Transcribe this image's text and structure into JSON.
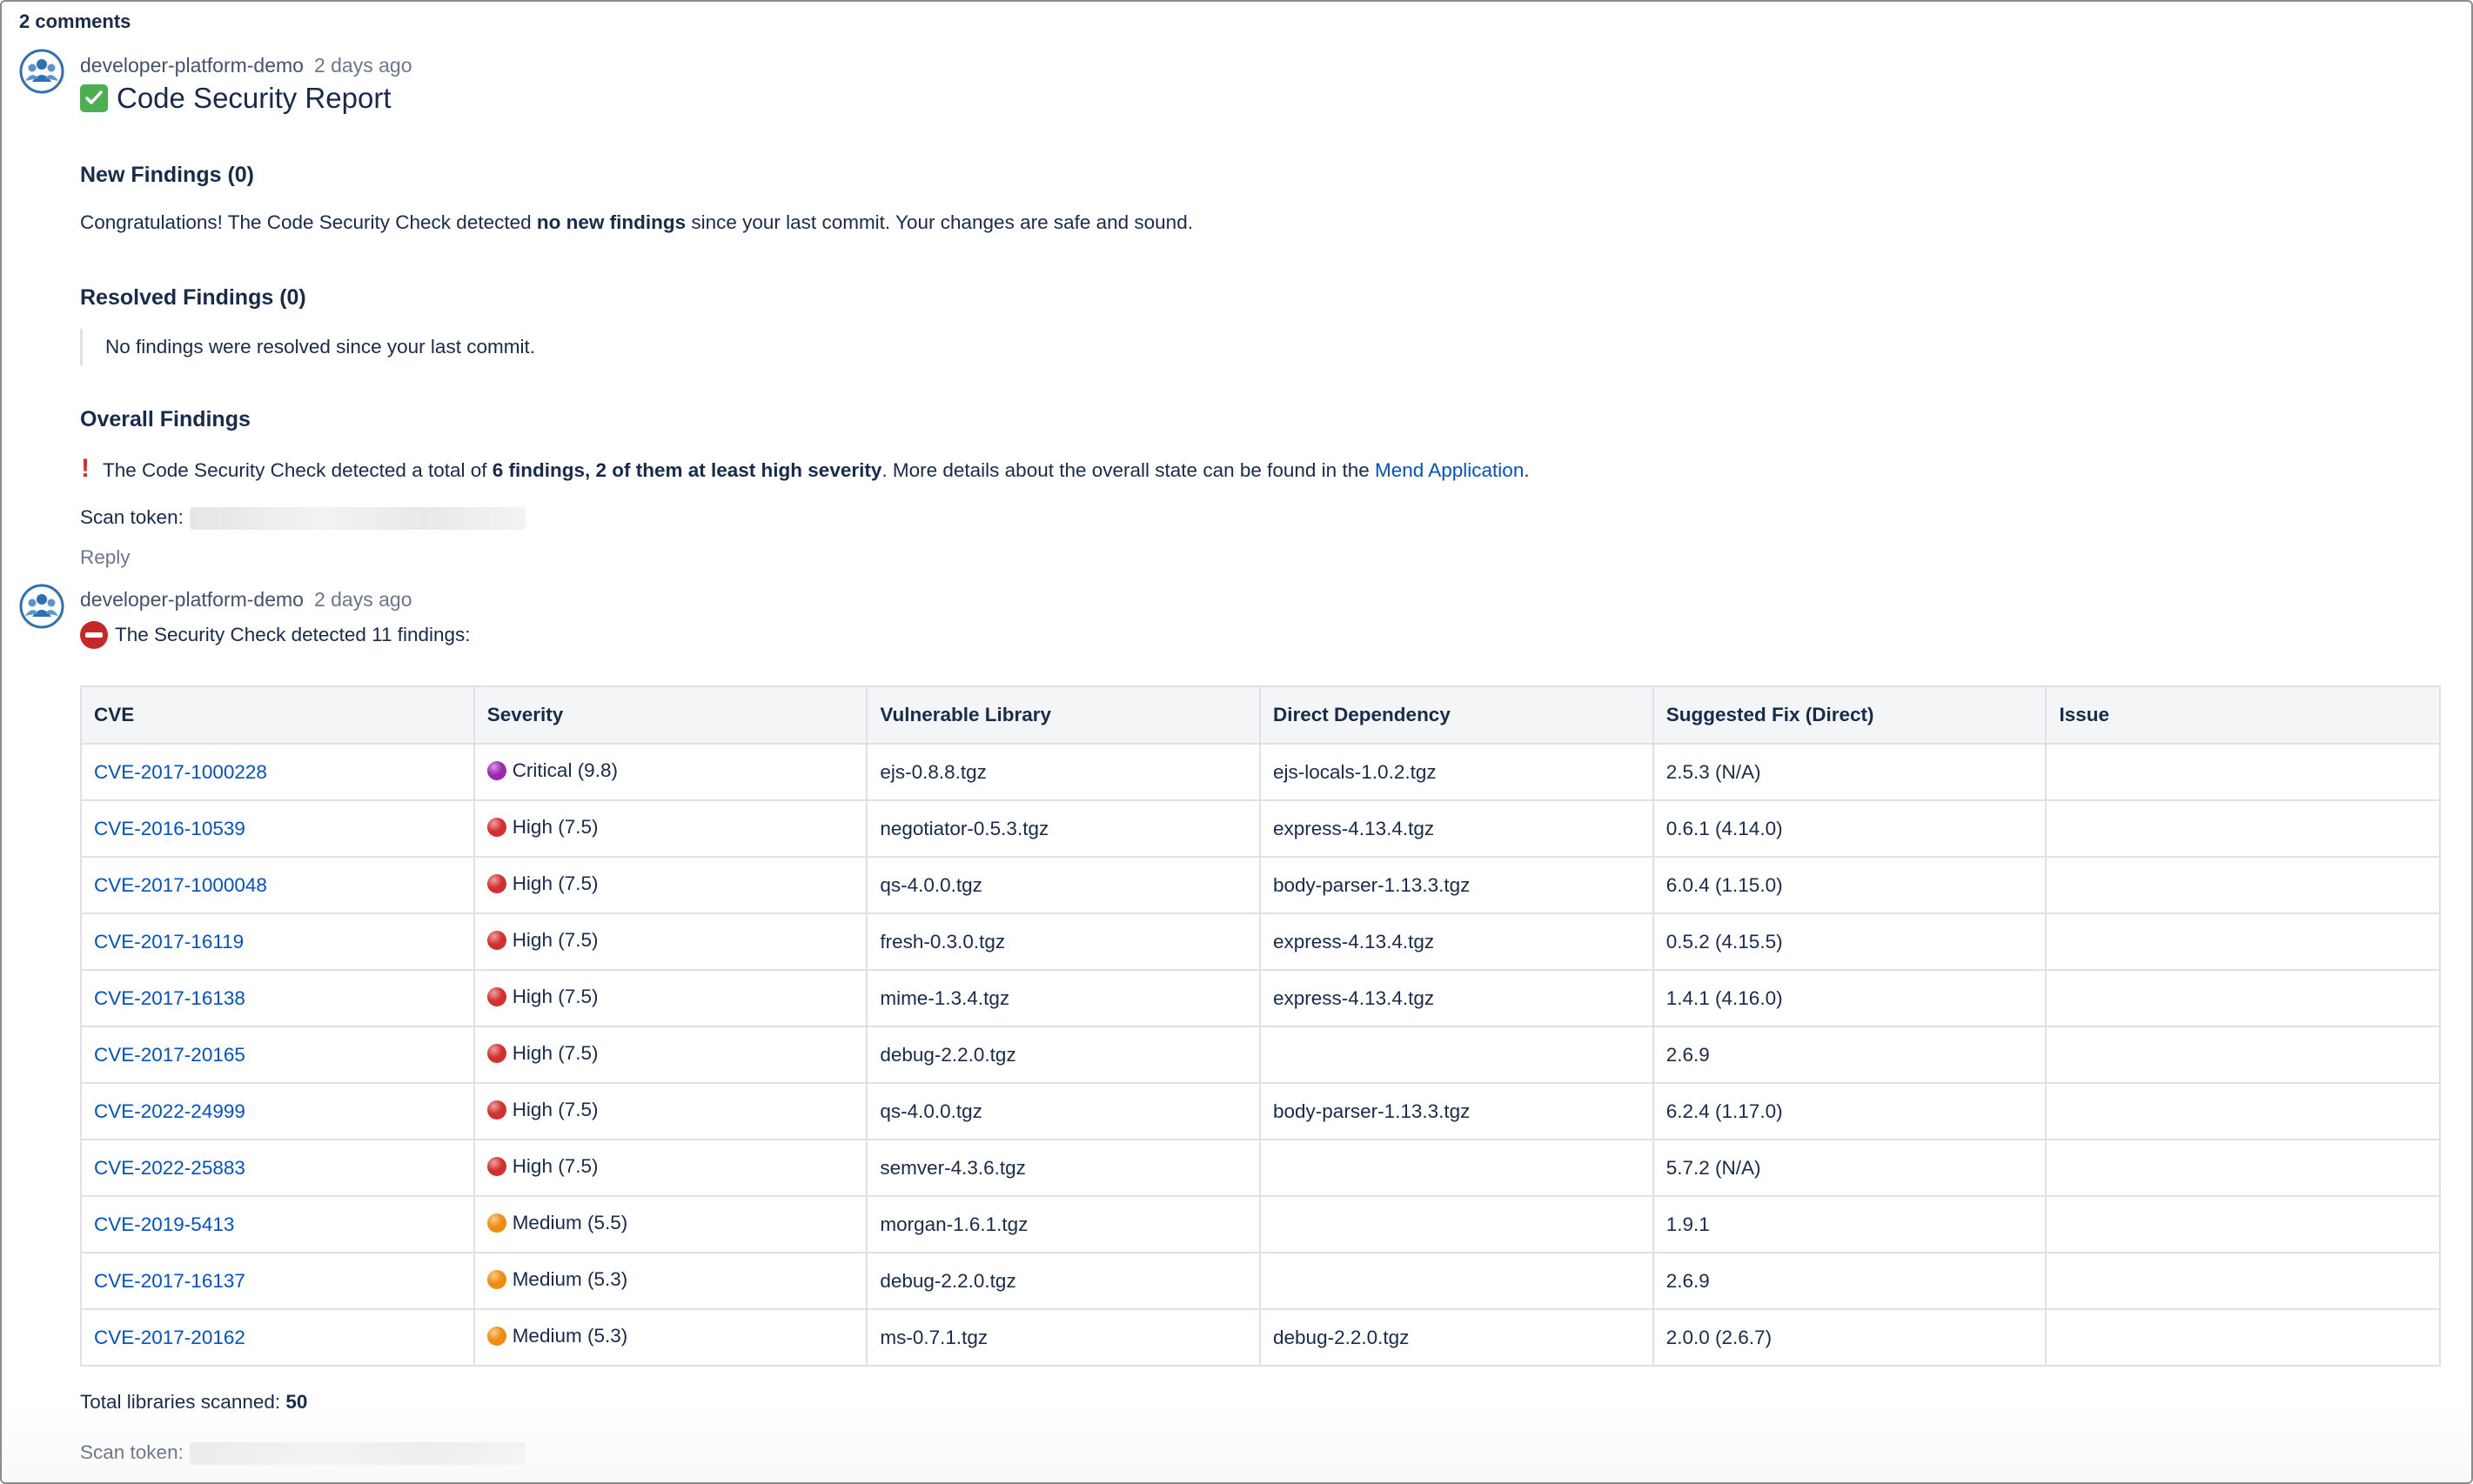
{
  "thread": {
    "comment_count": "2 comments"
  },
  "comment1": {
    "author": "developer-platform-demo",
    "time": "2 days ago",
    "title": "Code Security Report",
    "new_findings": {
      "heading": "New Findings (0)",
      "text_before": "Congratulations! The Code Security Check detected ",
      "text_bold": "no new findings",
      "text_after": " since your last commit. Your changes are safe and sound."
    },
    "resolved_findings": {
      "heading": "Resolved Findings (0)",
      "text": "No findings were resolved since your last commit."
    },
    "overall_findings": {
      "heading": "Overall Findings",
      "text_before": "The Code Security Check detected a total of ",
      "text_bold": "6 findings, 2 of them at least high severity",
      "text_middle": ". More details about the overall state can be found in the ",
      "link": "Mend Application",
      "text_after": "."
    },
    "scan_token_label": "Scan token:",
    "reply_label": "Reply"
  },
  "comment2": {
    "author": "developer-platform-demo",
    "time": "2 days ago",
    "summary": "The Security Check detected 11 findings:",
    "table": {
      "headers": [
        "CVE",
        "Severity",
        "Vulnerable Library",
        "Direct Dependency",
        "Suggested Fix (Direct)",
        "Issue"
      ],
      "rows": [
        {
          "cve": "CVE-2017-1000228",
          "severity": "Critical (9.8)",
          "level": "critical",
          "library": "ejs-0.8.8.tgz",
          "direct": "ejs-locals-1.0.2.tgz",
          "fix": "2.5.3 (N/A)",
          "issue": ""
        },
        {
          "cve": "CVE-2016-10539",
          "severity": "High (7.5)",
          "level": "high",
          "library": "negotiator-0.5.3.tgz",
          "direct": "express-4.13.4.tgz",
          "fix": "0.6.1 (4.14.0)",
          "issue": ""
        },
        {
          "cve": "CVE-2017-1000048",
          "severity": "High (7.5)",
          "level": "high",
          "library": "qs-4.0.0.tgz",
          "direct": "body-parser-1.13.3.tgz",
          "fix": "6.0.4 (1.15.0)",
          "issue": ""
        },
        {
          "cve": "CVE-2017-16119",
          "severity": "High (7.5)",
          "level": "high",
          "library": "fresh-0.3.0.tgz",
          "direct": "express-4.13.4.tgz",
          "fix": "0.5.2 (4.15.5)",
          "issue": ""
        },
        {
          "cve": "CVE-2017-16138",
          "severity": "High (7.5)",
          "level": "high",
          "library": "mime-1.3.4.tgz",
          "direct": "express-4.13.4.tgz",
          "fix": "1.4.1 (4.16.0)",
          "issue": ""
        },
        {
          "cve": "CVE-2017-20165",
          "severity": "High (7.5)",
          "level": "high",
          "library": "debug-2.2.0.tgz",
          "direct": "",
          "fix": "2.6.9",
          "issue": ""
        },
        {
          "cve": "CVE-2022-24999",
          "severity": "High (7.5)",
          "level": "high",
          "library": "qs-4.0.0.tgz",
          "direct": "body-parser-1.13.3.tgz",
          "fix": "6.2.4 (1.17.0)",
          "issue": ""
        },
        {
          "cve": "CVE-2022-25883",
          "severity": "High (7.5)",
          "level": "high",
          "library": "semver-4.3.6.tgz",
          "direct": "",
          "fix": "5.7.2 (N/A)",
          "issue": ""
        },
        {
          "cve": "CVE-2019-5413",
          "severity": "Medium (5.5)",
          "level": "medium",
          "library": "morgan-1.6.1.tgz",
          "direct": "",
          "fix": "1.9.1",
          "issue": ""
        },
        {
          "cve": "CVE-2017-16137",
          "severity": "Medium (5.3)",
          "level": "medium",
          "library": "debug-2.2.0.tgz",
          "direct": "",
          "fix": "2.6.9",
          "issue": ""
        },
        {
          "cve": "CVE-2017-20162",
          "severity": "Medium (5.3)",
          "level": "medium",
          "library": "ms-0.7.1.tgz",
          "direct": "debug-2.2.0.tgz",
          "fix": "2.0.0 (2.6.7)",
          "issue": ""
        }
      ]
    },
    "total_label": "Total libraries scanned: ",
    "total_value": "50",
    "scan_token_label": "Scan token:"
  },
  "colors": {
    "critical": "#9c27b0",
    "high": "#d32f2f",
    "medium": "#ef8c0e",
    "link": "#0052cc",
    "check": "#4caf50"
  },
  "icons": {
    "avatar": "user-group-avatar-icon",
    "report": "check-mark-box-icon",
    "overall": "exclamation-icon",
    "security": "no-entry-icon"
  }
}
